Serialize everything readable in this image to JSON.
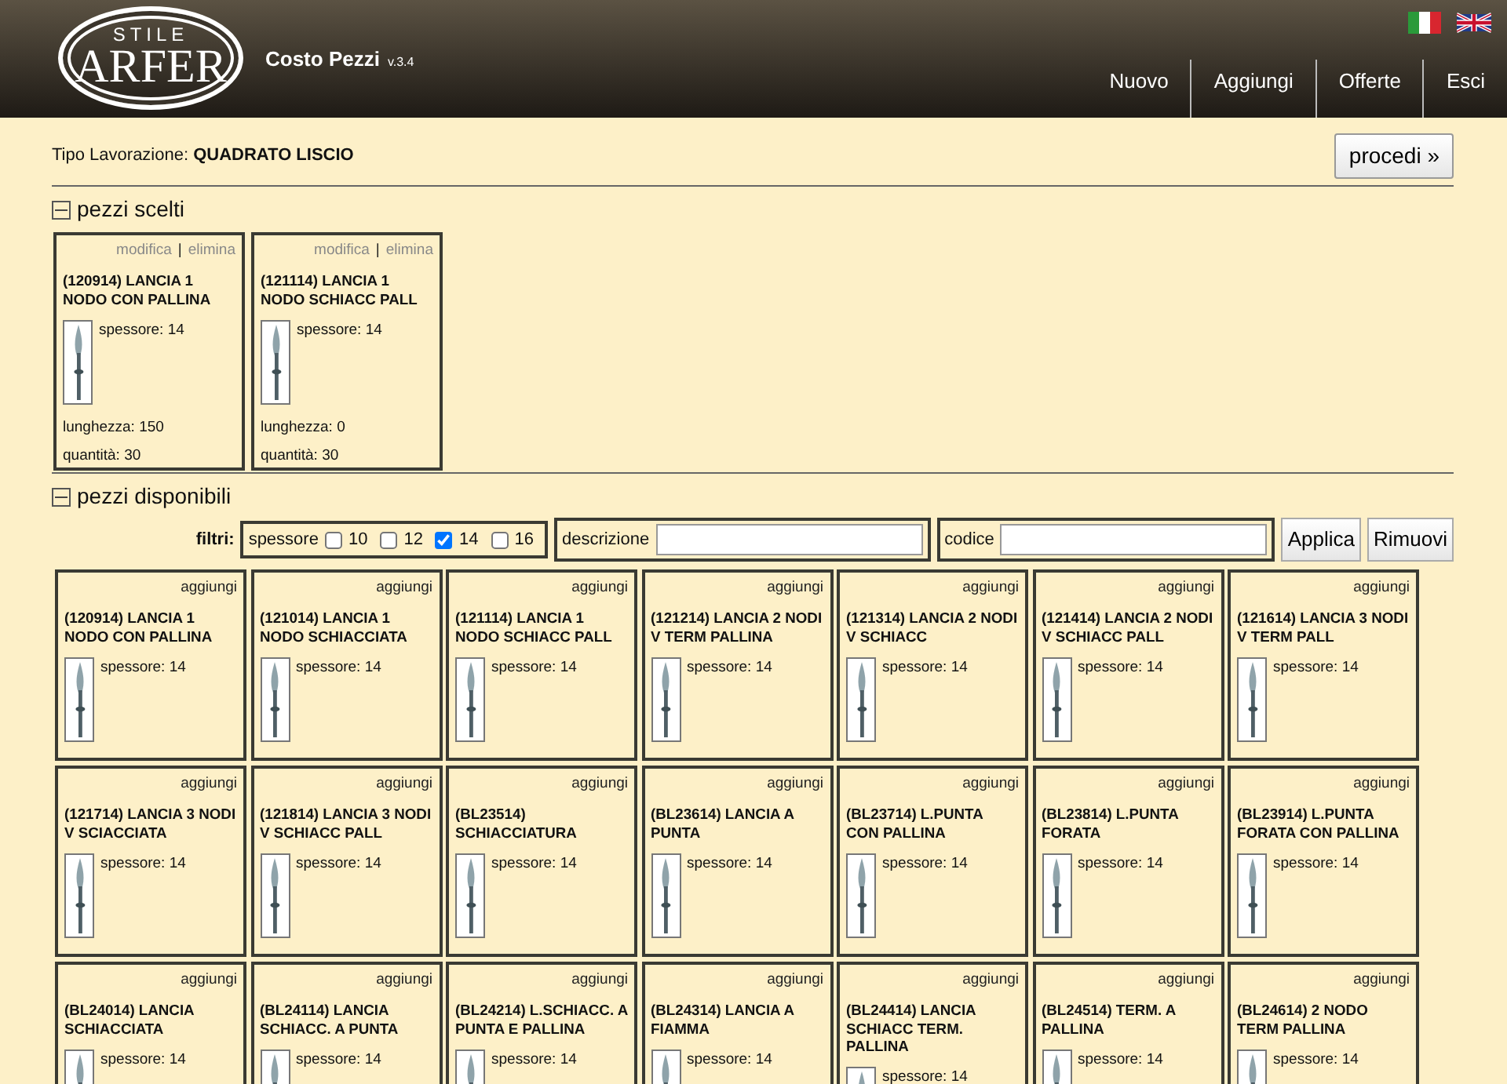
{
  "header": {
    "logo_top": "STILE",
    "logo_main": "ARFER",
    "app_title": "Costo Pezzi",
    "version": "v.3.4",
    "nav": [
      {
        "label": "Nuovo"
      },
      {
        "label": "Aggiungi"
      },
      {
        "label": "Offerte"
      },
      {
        "label": "Esci"
      }
    ]
  },
  "work_type": {
    "label": "Tipo Lavorazione:",
    "value": "QUADRATO LISCIO",
    "button": "procedi »"
  },
  "selected_section": {
    "title": "pezzi scelti",
    "expanded": true,
    "items": [
      {
        "edit": "modifica",
        "separator": "|",
        "remove": "elimina",
        "name": "(120914) LANCIA 1 NODO CON PALLINA",
        "thickness": "spessore: 14",
        "length": "lunghezza: 150",
        "quantity": "quantità: 30"
      },
      {
        "edit": "modifica",
        "separator": "|",
        "remove": "elimina",
        "name": "(121114) LANCIA 1 NODO SCHIACC PALL",
        "thickness": "spessore: 14",
        "length": "lunghezza: 0",
        "quantity": "quantità: 30"
      }
    ]
  },
  "available_section": {
    "title": "pezzi disponibili",
    "expanded": true,
    "filters": {
      "label": "filtri:",
      "thickness_label": "spessore",
      "thickness_options": [
        {
          "label": "10",
          "checked": false
        },
        {
          "label": "12",
          "checked": false
        },
        {
          "label": "14",
          "checked": true
        },
        {
          "label": "16",
          "checked": false
        }
      ],
      "description_label": "descrizione",
      "code_label": "codice",
      "apply_button": "Applica",
      "remove_button": "Rimuovi"
    },
    "items": [
      {
        "action": "aggiungi",
        "name": "(120914) LANCIA 1 NODO CON PALLINA",
        "thickness": "spessore: 14"
      },
      {
        "action": "aggiungi",
        "name": "(121014) LANCIA 1 NODO SCHIACCIATA",
        "thickness": "spessore: 14"
      },
      {
        "action": "aggiungi",
        "name": "(121114) LANCIA 1 NODO SCHIACC PALL",
        "thickness": "spessore: 14"
      },
      {
        "action": "aggiungi",
        "name": "(121214) LANCIA 2 NODI V TERM PALLINA",
        "thickness": "spessore: 14"
      },
      {
        "action": "aggiungi",
        "name": "(121314) LANCIA 2 NODI V SCHIACC",
        "thickness": "spessore: 14"
      },
      {
        "action": "aggiungi",
        "name": "(121414) LANCIA 2 NODI V SCHIACC PALL",
        "thickness": "spessore: 14"
      },
      {
        "action": "aggiungi",
        "name": "(121614) LANCIA 3 NODI V TERM PALL",
        "thickness": "spessore: 14"
      },
      {
        "action": "aggiungi",
        "name": "(121714) LANCIA 3 NODI V SCIACCIATA",
        "thickness": "spessore: 14"
      },
      {
        "action": "aggiungi",
        "name": "(121814) LANCIA 3 NODI V SCHIACC PALL",
        "thickness": "spessore: 14"
      },
      {
        "action": "aggiungi",
        "name": "(BL23514) SCHIACCIATURA",
        "thickness": "spessore: 14"
      },
      {
        "action": "aggiungi",
        "name": "(BL23614) LANCIA A PUNTA",
        "thickness": "spessore: 14"
      },
      {
        "action": "aggiungi",
        "name": "(BL23714) L.PUNTA CON PALLINA",
        "thickness": "spessore: 14"
      },
      {
        "action": "aggiungi",
        "name": "(BL23814) L.PUNTA FORATA",
        "thickness": "spessore: 14"
      },
      {
        "action": "aggiungi",
        "name": "(BL23914) L.PUNTA FORATA CON PALLINA",
        "thickness": "spessore: 14"
      },
      {
        "action": "aggiungi",
        "name": "(BL24014) LANCIA SCHIACCIATA",
        "thickness": "spessore: 14"
      },
      {
        "action": "aggiungi",
        "name": "(BL24114) LANCIA SCHIACC. A PUNTA",
        "thickness": "spessore: 14"
      },
      {
        "action": "aggiungi",
        "name": "(BL24214) L.SCHIACC. A PUNTA E PALLINA",
        "thickness": "spessore: 14"
      },
      {
        "action": "aggiungi",
        "name": "(BL24314) LANCIA A FIAMMA",
        "thickness": "spessore: 14"
      },
      {
        "action": "aggiungi",
        "name": "(BL24414) LANCIA SCHIACC TERM. PALLINA",
        "thickness": "spessore: 14"
      },
      {
        "action": "aggiungi",
        "name": "(BL24514) TERM. A PALLINA",
        "thickness": "spessore: 14"
      },
      {
        "action": "aggiungi",
        "name": "(BL24614) 2 NODO TERM PALLINA",
        "thickness": "spessore: 14"
      }
    ]
  }
}
